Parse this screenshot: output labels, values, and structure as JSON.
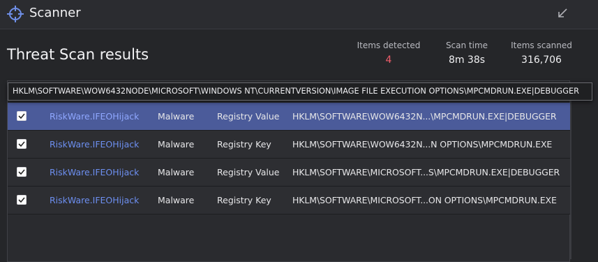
{
  "app": {
    "title": "Scanner"
  },
  "header": {
    "title": "Threat Scan results"
  },
  "stats": {
    "detected": {
      "label": "Items detected",
      "value": "4"
    },
    "scan_time": {
      "label": "Scan time",
      "value": "8m 38s"
    },
    "scanned": {
      "label": "Items scanned",
      "value": "316,706"
    }
  },
  "tooltip": "HKLM\\SOFTWARE\\WOW6432NODE\\MICROSOFT\\WINDOWS NT\\CURRENTVERSION\\IMAGE FILE EXECUTION OPTIONS\\MPCMDRUN.EXE|DEBUGGER",
  "rows": [
    {
      "name": "RiskWare.IFEOHijack",
      "category": "Malware",
      "type": "Registry Value",
      "location": "HKLM\\SOFTWARE\\WOW6432N...\\MPCMDRUN.EXE|DEBUGGER",
      "checked": true,
      "selected": true
    },
    {
      "name": "RiskWare.IFEOHijack",
      "category": "Malware",
      "type": "Registry Key",
      "location": "HKLM\\SOFTWARE\\WOW6432N...N OPTIONS\\MPCMDRUN.EXE",
      "checked": true,
      "selected": false
    },
    {
      "name": "RiskWare.IFEOHijack",
      "category": "Malware",
      "type": "Registry Value",
      "location": "HKLM\\SOFTWARE\\MICROSOFT...S\\MPCMDRUN.EXE|DEBUGGER",
      "checked": true,
      "selected": false
    },
    {
      "name": "RiskWare.IFEOHijack",
      "category": "Malware",
      "type": "Registry Key",
      "location": "HKLM\\SOFTWARE\\MICROSOFT...ON OPTIONS\\MPCMDRUN.EXE",
      "checked": true,
      "selected": false
    }
  ],
  "icons": {
    "logo": "crosshair-icon",
    "minimize": "minimize-arrow-icon",
    "check": "checkmark-icon"
  },
  "colors": {
    "accent": "#4b5b9a",
    "link": "#6d8ff0",
    "alert": "#ef5d6b"
  }
}
